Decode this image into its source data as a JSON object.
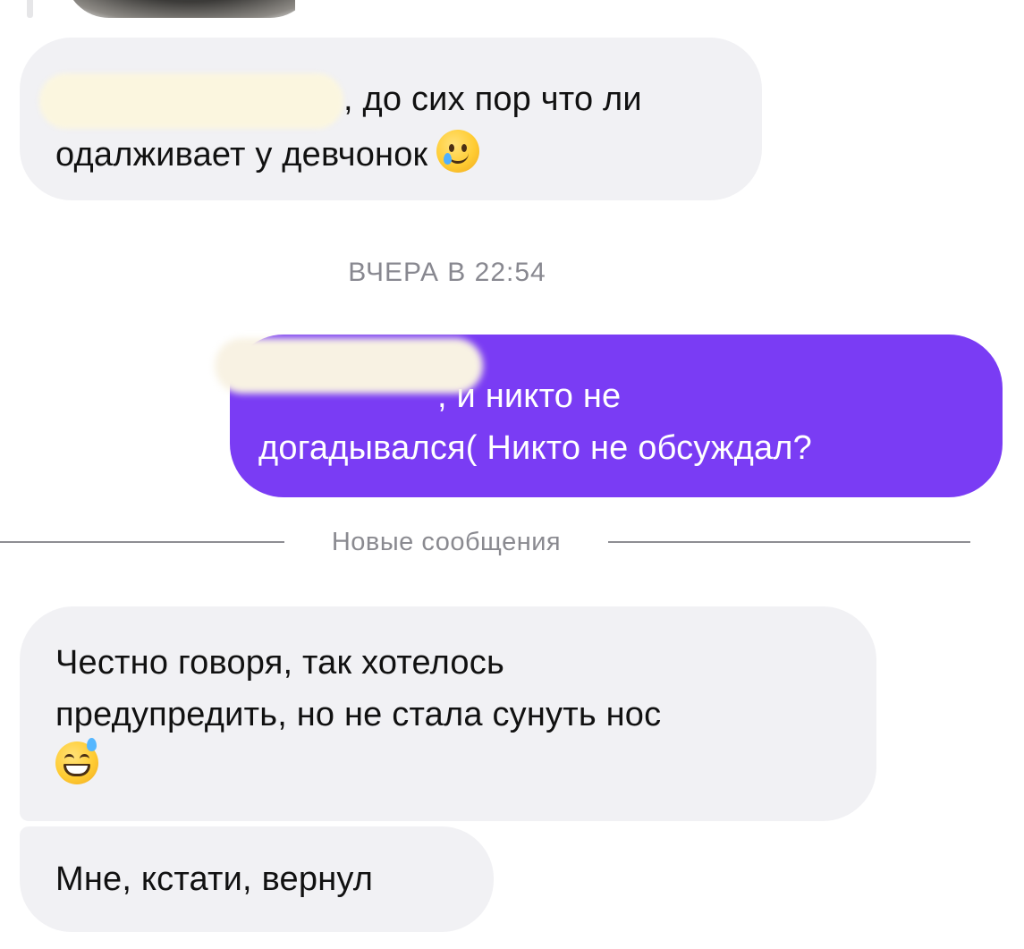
{
  "conversation": {
    "messages": [
      {
        "direction": "incoming",
        "text_line1": ", до сих пор что ли",
        "text_line2": "одалживает у девчонок",
        "emoji": "crying-smile-icon"
      },
      {
        "direction": "outgoing",
        "text_line1": ", и никто не",
        "text_line2": "догадывался( Никто не обсуждал?"
      },
      {
        "direction": "incoming",
        "text_line1": "Честно говоря, так хотелось",
        "text_line2": "предупредить, но не стала сунуть нос",
        "emoji": "grinning-sweat-icon"
      },
      {
        "direction": "incoming",
        "text_line1": "Мне, кстати, вернул"
      }
    ],
    "timestamp": "ВЧЕРА В 22:54",
    "new_messages_divider": "Новые сообщения"
  },
  "colors": {
    "incoming_bubble": "#f1f1f4",
    "outgoing_bubble": "#7a3cf4",
    "outgoing_text": "#ffffff",
    "meta_text": "#888890"
  }
}
